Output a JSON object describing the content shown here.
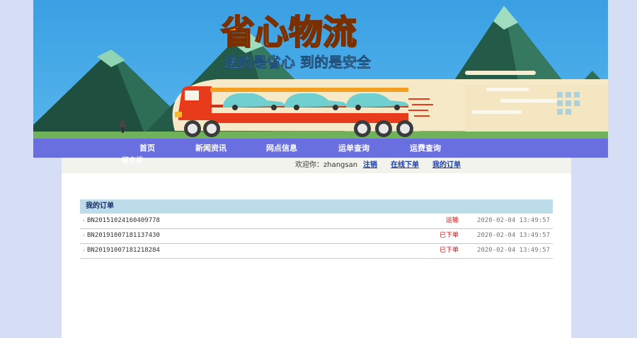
{
  "banner": {
    "title": "省心物流",
    "slogan": "送的是省心 到的是安全"
  },
  "nav": {
    "items": [
      {
        "label": "首页"
      },
      {
        "label": "新闻资讯"
      },
      {
        "label": "网点信息"
      },
      {
        "label": "运单查询"
      },
      {
        "label": "运费查询"
      }
    ],
    "overflow_label": "留言板"
  },
  "user_bar": {
    "welcome": "欢迎你：zhangsan",
    "logout": "注销",
    "place_order": "在线下单",
    "my_orders": "我的订单"
  },
  "orders_panel": {
    "title": "我的订单",
    "rows": [
      {
        "order_no": "BN20151024160409778",
        "status": "运输",
        "time": "2020-02-04 13:49:57"
      },
      {
        "order_no": "BN20191007181137430",
        "status": "已下单",
        "time": "2020-02-04 13:49:57"
      },
      {
        "order_no": "BN20191007181218284",
        "status": "已下单",
        "time": "2020-02-04 13:49:57"
      }
    ]
  },
  "colors": {
    "page_bg": "#d5def5",
    "sky": "#3a9de0",
    "nav_bg": "#6a6fe0",
    "title_orange": "#ff9a1f",
    "truck_red": "#e83b1b",
    "status_red": "#cc1111",
    "panel_head": "#bcdcea"
  },
  "icons": {
    "row_bullet": "bullet-arrow-icon"
  }
}
